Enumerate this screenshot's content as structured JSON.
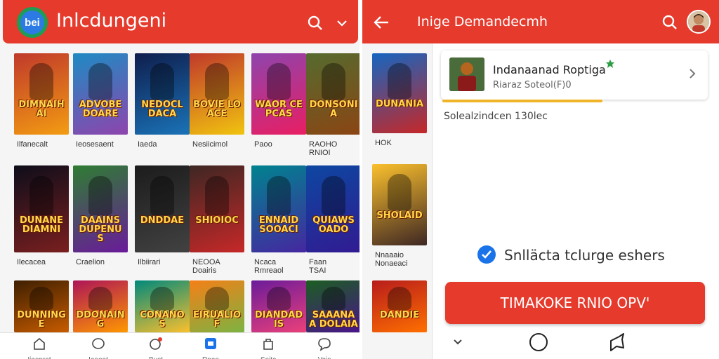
{
  "left_panel": {
    "header": {
      "logo_text": "bei",
      "title": "Inlcdungeni",
      "icons": [
        "search-icon",
        "chevron-down-icon"
      ]
    },
    "tiles": [
      {
        "poster": "DIMNAIHAI",
        "caption": "Ilfanecalt",
        "colors": [
          "#c0392b",
          "#f39c12"
        ]
      },
      {
        "poster": "ADVOBE DOARE",
        "caption": "Ieosesaent",
        "colors": [
          "#1e8bc3",
          "#8e44ad"
        ]
      },
      {
        "poster": "NEDOCLDACA",
        "caption": "Iaeda",
        "colors": [
          "#0f1e4d",
          "#1a73b8"
        ]
      },
      {
        "poster": "BOVIE LOACE",
        "caption": "Nesiicimol",
        "colors": [
          "#c0392b",
          "#f1c40f"
        ]
      },
      {
        "poster": "WAOR CEPCAS",
        "caption": "Paoo",
        "colors": [
          "#8e44ad",
          "#e91e63"
        ]
      },
      {
        "poster": "DONSONIA",
        "caption": "RAOHO\nRNIOI",
        "colors": [
          "#556b2f",
          "#8b4513"
        ]
      },
      {
        "poster": "DUNANE DIAMNI",
        "caption": "Ilecacea",
        "colors": [
          "#0d0d1a",
          "#7a1f1f"
        ]
      },
      {
        "poster": "DAAINS DUPENUS",
        "caption": "Craelion",
        "colors": [
          "#2e7d32",
          "#6a1b9a"
        ]
      },
      {
        "poster": "DNDDAE",
        "caption": "Ilbiirari",
        "colors": [
          "#1c1c1c",
          "#424242"
        ]
      },
      {
        "poster": "SHIOIOC",
        "caption": "NEOOA\nDoairis",
        "colors": [
          "#3e2723",
          "#c62828"
        ]
      },
      {
        "poster": "ENNAID SOOACI",
        "caption": "Ncaca\nRmreaol",
        "colors": [
          "#00838f",
          "#4527a0"
        ]
      },
      {
        "poster": "QUIAWS OADO",
        "caption": "Faan\nTSAI",
        "colors": [
          "#0d47a1",
          "#311b92"
        ]
      },
      {
        "poster": "DUNNINGE",
        "caption": "",
        "colors": [
          "#3e1f00",
          "#c75b00"
        ]
      },
      {
        "poster": "DDONAING",
        "caption": "",
        "colors": [
          "#ad1457",
          "#ff9800"
        ]
      },
      {
        "poster": "CONANOS",
        "caption": "",
        "colors": [
          "#00897b",
          "#fbc02d"
        ]
      },
      {
        "poster": "EIRUALIOF",
        "caption": "",
        "colors": [
          "#f57f17",
          "#7cb342"
        ]
      },
      {
        "poster": "DIANDADIS",
        "caption": "",
        "colors": [
          "#6a1b9a",
          "#ec407a"
        ]
      },
      {
        "poster": "SAAANAA DOLAIA",
        "caption": "",
        "colors": [
          "#1b5e20",
          "#4a148c"
        ]
      }
    ],
    "bottom_nav": [
      {
        "icon": "home-icon",
        "label": "Iiaonrat"
      },
      {
        "icon": "chat-icon",
        "label": "Iaoeat"
      },
      {
        "icon": "gift-icon",
        "label": "Bust"
      },
      {
        "icon": "apps-icon",
        "label": "Rnao"
      },
      {
        "icon": "bag-icon",
        "label": "Soitc"
      },
      {
        "icon": "comment-icon",
        "label": "Vais"
      }
    ]
  },
  "right_panel": {
    "header": {
      "title": "Inige Demandecmh",
      "icons": [
        "back-arrow-icon",
        "search-icon",
        "avatar"
      ]
    },
    "side_tiles": [
      {
        "poster": "DUNANIA",
        "caption": "HOK",
        "colors": [
          "#1565c0",
          "#c62828"
        ]
      },
      {
        "poster": "SHOLAID",
        "caption": "Nnaaaio\nNonaeaci",
        "colors": [
          "#fbc02d",
          "#3e2723"
        ]
      },
      {
        "poster": "DANDIE",
        "caption": "",
        "colors": [
          "#b71c1c",
          "#ff6f00"
        ]
      }
    ],
    "app_card": {
      "name": "Indanaanad Roptiga",
      "subtitle": "Riaraz Soteol(F)0",
      "progress": 0.6
    },
    "status_text": "Solealzindcen   130lec",
    "checkbox_label": "Snlläcta tclurge eshers",
    "cta_label": "TIMAKOKE RNIO OPV'",
    "system_nav": [
      "chevron-down-icon",
      "home-circle-icon",
      "share-icon"
    ]
  },
  "colors": {
    "accent": "#e53a2c",
    "check": "#1a73e8",
    "progress": "#f0b429"
  }
}
